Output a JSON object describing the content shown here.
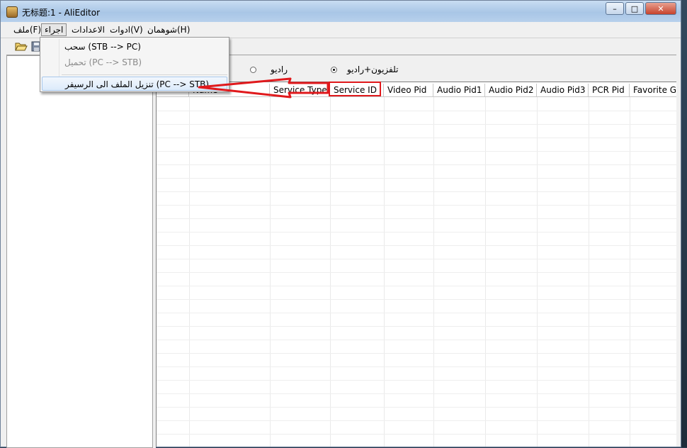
{
  "window": {
    "title": "无标题:1 - AliEditor"
  },
  "window_buttons": {
    "minimize": "–",
    "maximize": "□",
    "close": "✕"
  },
  "menubar": [
    {
      "label": "ملف(F)"
    },
    {
      "label": "اجراء"
    },
    {
      "label": "الاعدادات"
    },
    {
      "label": "ادوات(V)"
    },
    {
      "label": "شوهمان(H)"
    }
  ],
  "dropdown": {
    "items": [
      {
        "label": "سحب (STB --> PC)",
        "enabled": true
      },
      {
        "label": "تحميل (PC --> STB)",
        "enabled": false
      },
      {
        "label": "تنزيل الملف الى الرسيفر (PC --> STB)",
        "enabled": true
      }
    ]
  },
  "toolbar": {
    "icons": [
      "open-folder-icon",
      "save-icon"
    ]
  },
  "radios": {
    "tv_radio": {
      "label": "تلفزيون+راديو",
      "checked": true
    },
    "radio": {
      "label": "راديو",
      "checked": false
    }
  },
  "grid": {
    "columns": [
      "",
      "Name",
      "Service Type",
      "Service ID",
      "Video Pid",
      "Audio Pid1",
      "Audio Pid2",
      "Audio Pid3",
      "PCR Pid",
      "Favorite Gr"
    ]
  },
  "annotation": {
    "color": "#e0191c"
  }
}
